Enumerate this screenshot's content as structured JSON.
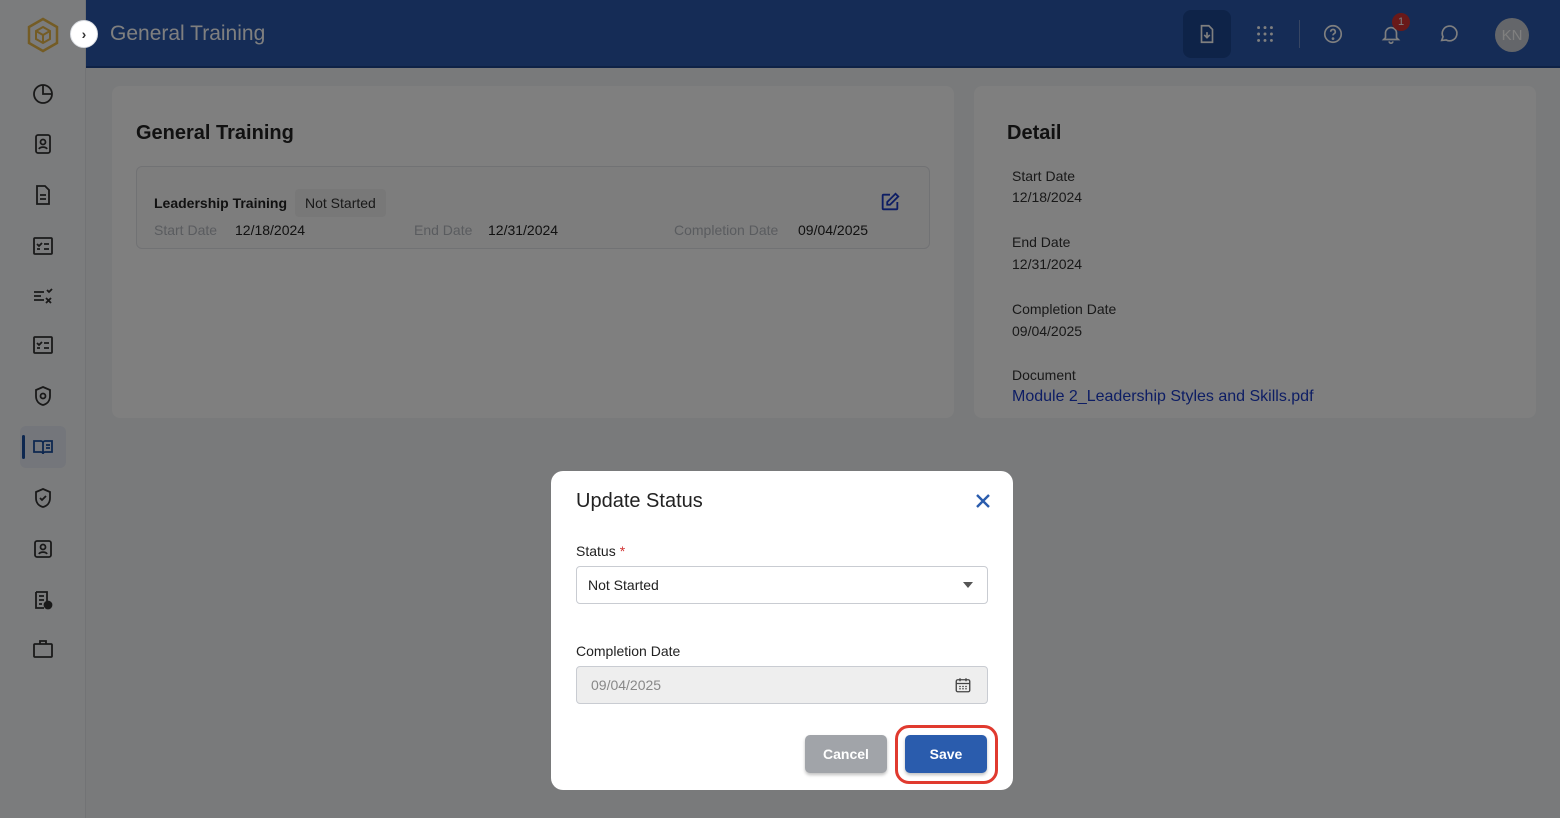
{
  "header": {
    "title": "General Training",
    "notifications_count": "1",
    "avatar_initials": "KN"
  },
  "training_card": {
    "title": "General Training",
    "item": {
      "name": "Leadership Training",
      "status": "Not Started",
      "start_date_label": "Start Date",
      "start_date": "12/18/2024",
      "end_date_label": "End Date",
      "end_date": "12/31/2024",
      "completion_date_label": "Completion Date",
      "completion_date": "09/04/2025"
    }
  },
  "detail": {
    "title": "Detail",
    "start_date_label": "Start Date",
    "start_date": "12/18/2024",
    "end_date_label": "End Date",
    "end_date": "12/31/2024",
    "completion_date_label": "Completion Date",
    "completion_date": "09/04/2025",
    "document_label": "Document",
    "document_link": "Module 2_Leadership Styles and Skills.pdf"
  },
  "modal": {
    "title": "Update Status",
    "status_label": "Status",
    "required_mark": "*",
    "status_value": "Not Started",
    "completion_date_label": "Completion Date",
    "completion_date_value": "09/04/2025",
    "cancel_label": "Cancel",
    "save_label": "Save"
  },
  "colors": {
    "header": "#2a59ac",
    "primary": "#2a5cad",
    "link": "#1b3bc8",
    "highlight_ring": "#e03a2f"
  }
}
